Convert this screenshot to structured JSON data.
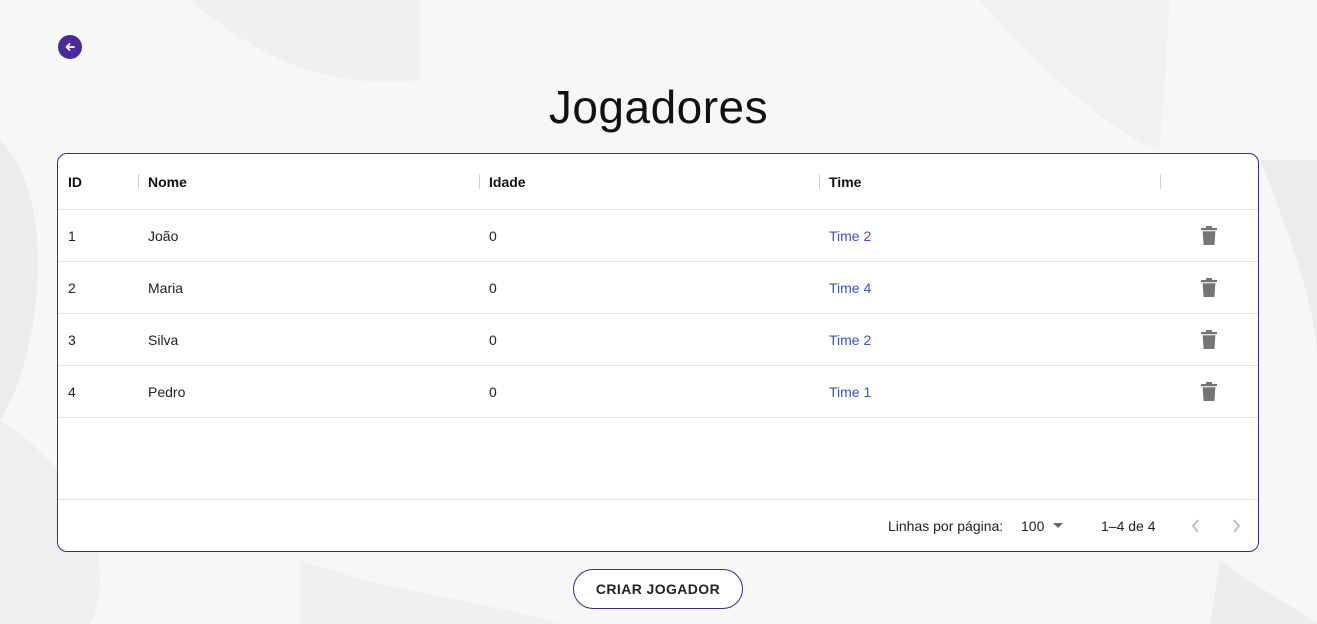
{
  "page": {
    "title": "Jogadores"
  },
  "table": {
    "columns": [
      "ID",
      "Nome",
      "Idade",
      "Time"
    ],
    "rows": [
      {
        "id": "1",
        "nome": "João",
        "idade": "0",
        "time": "Time 2"
      },
      {
        "id": "2",
        "nome": "Maria",
        "idade": "0",
        "time": "Time 4"
      },
      {
        "id": "3",
        "nome": "Silva",
        "idade": "0",
        "time": "Time 2"
      },
      {
        "id": "4",
        "nome": "Pedro",
        "idade": "0",
        "time": "Time 1"
      }
    ],
    "footer": {
      "rows_per_page_label": "Linhas por página:",
      "rows_per_page_value": "100",
      "range": "1–4 de 4"
    }
  },
  "actions": {
    "create_label": "CRIAR JOGADOR"
  },
  "icons": {
    "back": "arrow-left-circle-icon",
    "delete": "trash-icon",
    "dropdown": "caret-down-icon",
    "prev": "chevron-left-icon",
    "next": "chevron-right-icon"
  },
  "colors": {
    "accent": "#4b2a9a",
    "link": "#3b4fd8",
    "border": "#3b2a8c"
  }
}
